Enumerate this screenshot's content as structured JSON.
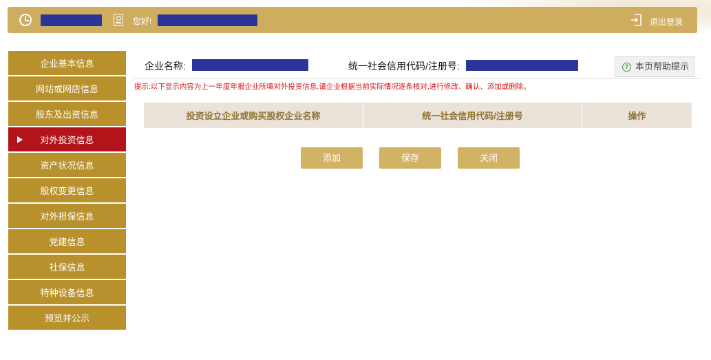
{
  "header": {
    "greeting": "您好!",
    "logout_label": "退出登录"
  },
  "sidebar": {
    "items": [
      {
        "label": "企业基本信息"
      },
      {
        "label": "网站或网店信息"
      },
      {
        "label": "股东及出资信息"
      },
      {
        "label": "对外投资信息",
        "active": true
      },
      {
        "label": "资产状况信息"
      },
      {
        "label": "股权变更信息"
      },
      {
        "label": "对外担保信息"
      },
      {
        "label": "党建信息"
      },
      {
        "label": "社保信息"
      },
      {
        "label": "特种设备信息"
      },
      {
        "label": "预览并公示"
      }
    ]
  },
  "main": {
    "company_label": "企业名称:",
    "code_label": "统一社会信用代码/注册号:",
    "help_button": "本页帮助提示",
    "tip": "提示:以下显示内容为上一年度年报企业所填对外投资信息,请企业根据当前实际情况逐条核对,进行修改、确认、添加或删除。",
    "table": {
      "headers": [
        "投资设立企业或购买股权企业名称",
        "统一社会信用代码/注册号",
        "操作"
      ]
    },
    "buttons": {
      "add": "添加",
      "save": "保存",
      "close": "关闭"
    }
  },
  "colors": {
    "topbar": "#cfad5e",
    "sidebar_item": "#b8912d",
    "sidebar_active": "#b3141a",
    "redaction": "#2b349b",
    "button": "#d2b264",
    "tip_text": "#dd1111"
  }
}
